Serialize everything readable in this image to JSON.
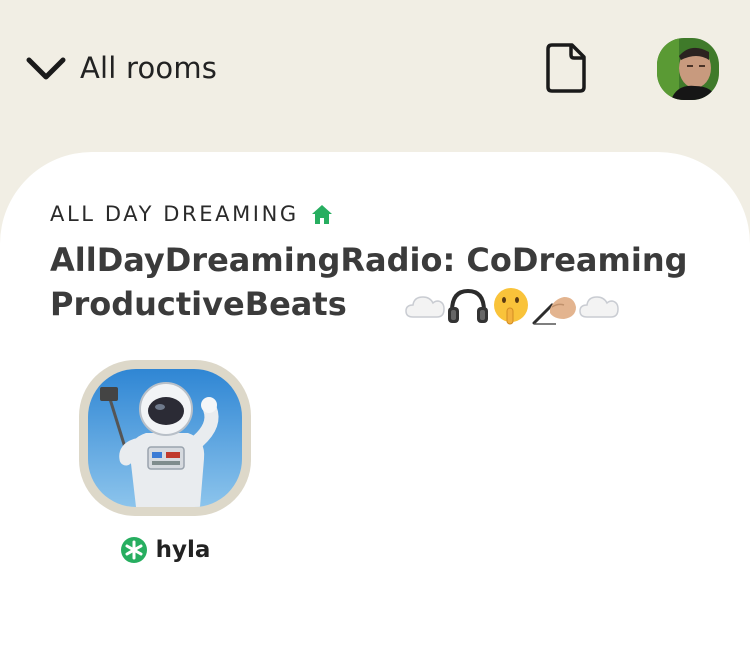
{
  "header": {
    "back_label": "All rooms",
    "icons": [
      "chevron-down-icon",
      "document-icon",
      "profile-avatar"
    ]
  },
  "room": {
    "club_name": "ALL DAY DREAMING",
    "club_icon": "house-icon",
    "title_line1": "AllDayDreamingRadio: CoDreaming",
    "title_line2": "ProductiveBeats",
    "title_emoji": [
      "cloud-icon",
      "headphones-icon",
      "shushing-face-icon",
      "writing-hand-icon",
      "cloud-icon"
    ]
  },
  "speakers": [
    {
      "name": "hyla",
      "badge": "new-member-icon",
      "avatar": "astronaut-selfie"
    }
  ],
  "colors": {
    "background": "#f1eee4",
    "card": "#ffffff",
    "club_green": "#27ae60",
    "speaker_frame": "#ddd8c9",
    "text": "#242424"
  }
}
